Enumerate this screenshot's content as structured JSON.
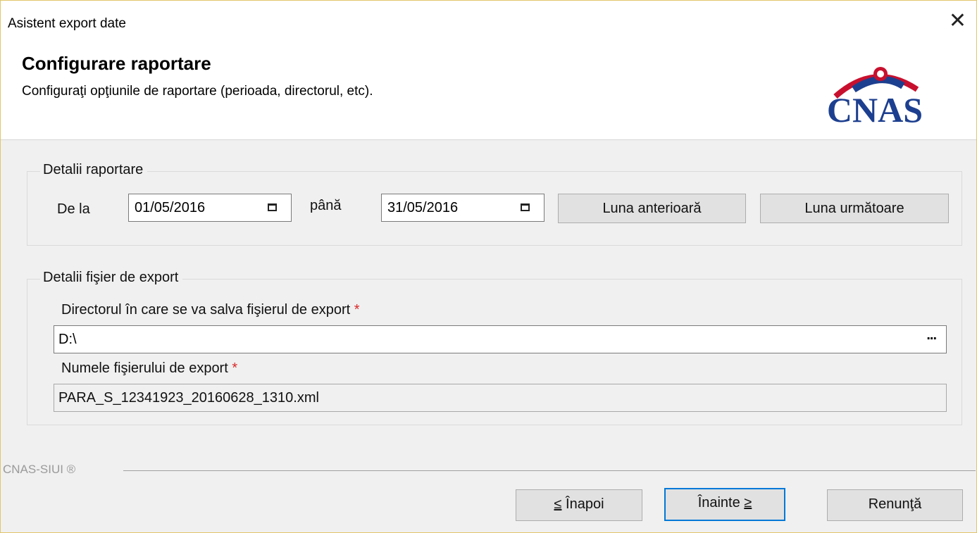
{
  "window": {
    "title": "Asistent export date",
    "close_symbol": "✕"
  },
  "header": {
    "title": "Configurare raportare",
    "subtitle": "Configuraţi opţiunile de raportare (perioada, directorul, etc).",
    "logo_text": "CNAS",
    "logo_icon": "cnas-logo-icon"
  },
  "reporting": {
    "legend": "Detalii raportare",
    "from_label": "De la",
    "from_value": "01/05/2016",
    "to_label": "până",
    "to_value": "31/05/2016",
    "prev_month_label": "Luna anterioară",
    "next_month_label": "Luna următoare"
  },
  "export_file": {
    "legend": "Detalii fişier de export",
    "directory_label": "Directorul în care se va salva fişierul de export",
    "directory_value": "D:\\",
    "browse_label": "...",
    "filename_label": "Numele fişierului de export",
    "filename_value": "PARA_S_12341923_20160628_1310.xml",
    "required_mark": "*"
  },
  "footer": {
    "brand": "CNAS-SIUI ®",
    "back_label": "Înapoi",
    "back_prefix": "≤",
    "next_label": "Înainte",
    "next_suffix": "≥",
    "cancel_label": "Renunţă"
  },
  "colors": {
    "accent": "#0078d7",
    "required": "#d92a2a",
    "logo_blue": "#1d3f8f",
    "logo_red": "#c8102e"
  }
}
